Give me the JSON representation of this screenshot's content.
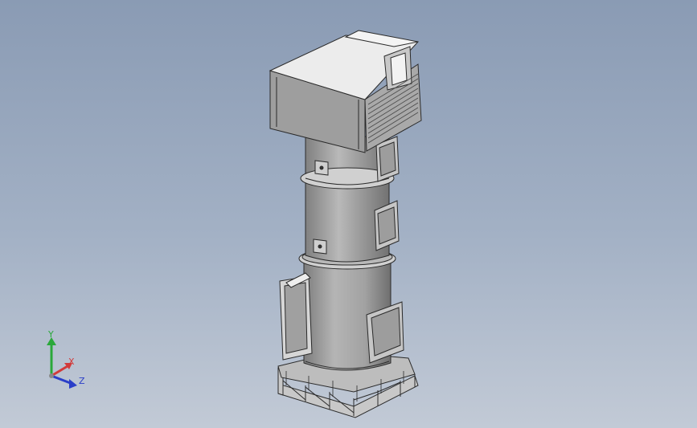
{
  "viewport": {
    "background_top": "#8a9bb4",
    "background_bottom": "#c2cad6"
  },
  "model": {
    "description_icon": "tower-assembly-icon",
    "body_color": "#a9a9a9",
    "edge_color": "#2b2b2b",
    "highlight_color": "#e6e6e6"
  },
  "triad": {
    "x_label": "X",
    "y_label": "Y",
    "z_label": "Z",
    "x_color": "#d23a3a",
    "y_color": "#2aa83a",
    "z_color": "#2a3ec8"
  }
}
